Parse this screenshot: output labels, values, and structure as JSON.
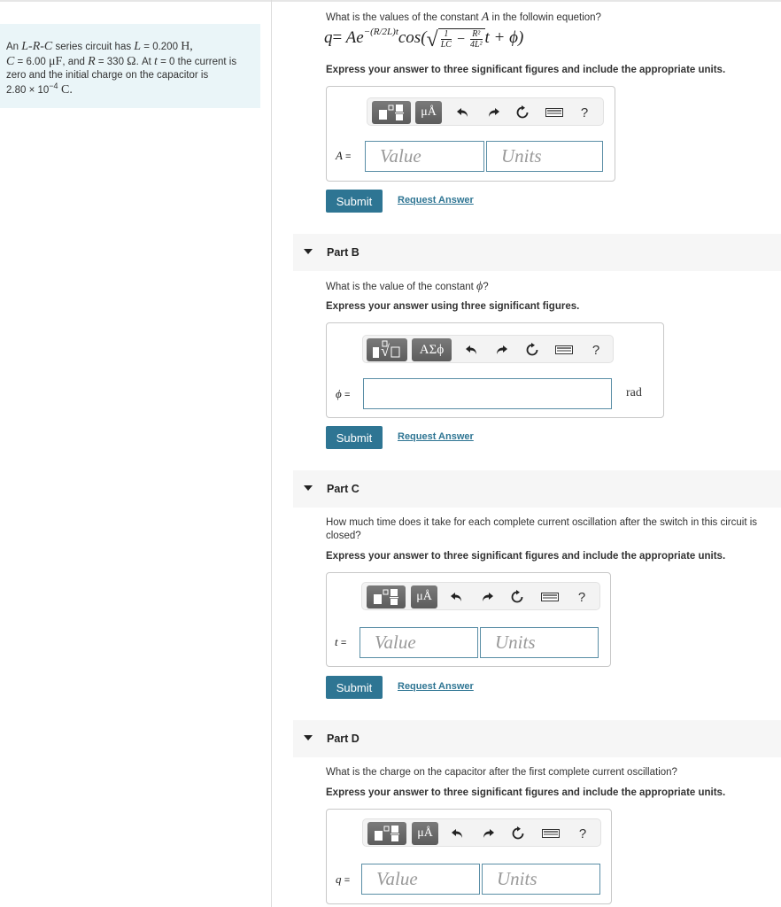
{
  "intro": {
    "line1_pre": "An ",
    "L_R_C": "L-R-C",
    "line1_mid": " series circuit has ",
    "L_sym": "L",
    "L_val": " = 0.200 ",
    "L_unit": "H,",
    "C_sym": "C",
    "C_val": " = 6.00 ",
    "C_unit": "μF",
    "C_post": ", and ",
    "R_sym": "R",
    "R_val": " = 330 ",
    "R_unit": "Ω",
    "R_post": ". At ",
    "t_sym": "t",
    "t_post": " = 0 the current is zero and the initial charge on the capacitor is",
    "q0_mant": "2.80 × 10",
    "q0_exp": "−4",
    "q0_unit": " C."
  },
  "partA": {
    "question_pre": "What is the values of the constant ",
    "question_var": "A",
    "question_post": " in the followin equetion?",
    "equation": {
      "lhs": "q",
      "eq": "= Ae",
      "exponent": "−(R/2L)t",
      "cos": "cos(",
      "frac1_num": "1",
      "frac1_den": "LC",
      "minus": " − ",
      "frac2_num": "R²",
      "frac2_den": "4L²",
      "tail": "t + ϕ)"
    },
    "instruction": "Express your answer to three significant figures and include the appropriate units.",
    "var_label": "A",
    "value_placeholder": "Value",
    "units_placeholder": "Units",
    "submit": "Submit",
    "request": "Request Answer"
  },
  "toolbar": {
    "units_symbol": "μÅ",
    "greek_symbol": "ΑΣϕ",
    "help": "?"
  },
  "partB": {
    "title": "Part B",
    "question_pre": "What is the value of the constant ",
    "question_var": "ϕ",
    "question_post": "?",
    "instruction": "Express your answer using three significant figures.",
    "var_label": "ϕ",
    "unit": "rad",
    "submit": "Submit",
    "request": "Request Answer"
  },
  "partC": {
    "title": "Part C",
    "question": "How much time does it take for each complete current oscillation after the switch in this circuit is closed?",
    "instruction": "Express your answer to three significant figures and include the appropriate units.",
    "var_label": "t",
    "value_placeholder": "Value",
    "units_placeholder": "Units",
    "submit": "Submit",
    "request": "Request Answer"
  },
  "partD": {
    "title": "Part D",
    "question": "What is the charge on the capacitor after the first complete current oscillation?",
    "instruction": "Express your answer to three significant figures and include the appropriate units.",
    "var_label": "q",
    "value_placeholder": "Value",
    "units_placeholder": "Units"
  },
  "equals": "="
}
